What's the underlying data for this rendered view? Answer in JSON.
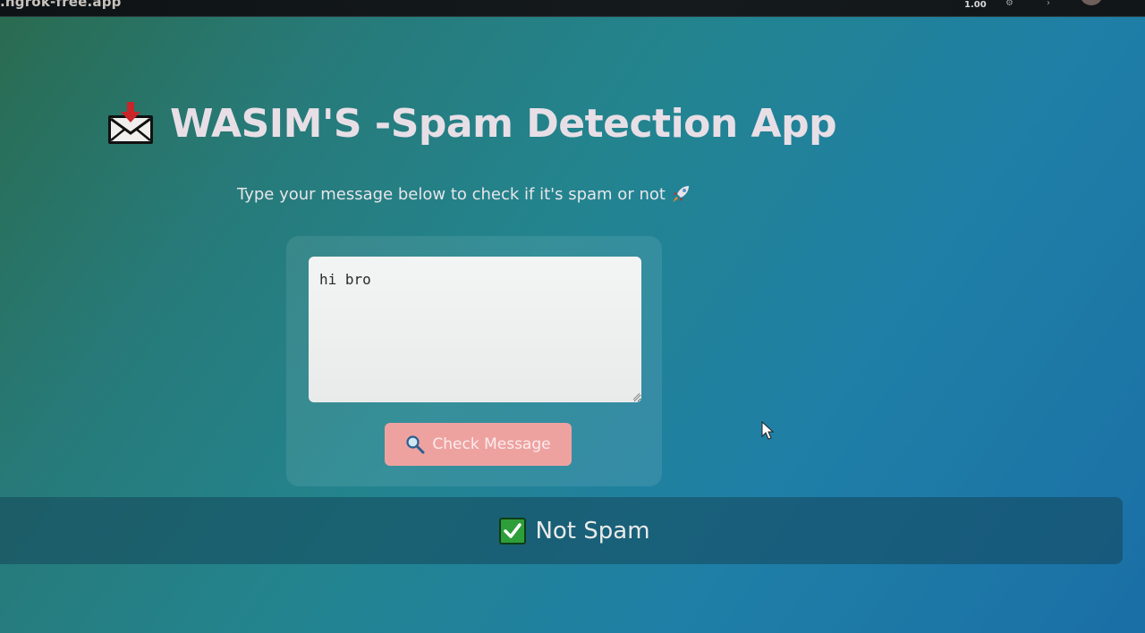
{
  "browser": {
    "url_fragment": ".ngrok-free.app",
    "zoom_level": "1.00"
  },
  "header": {
    "icon": "inbox-tray-icon",
    "title": "WASIM'S -Spam Detection App"
  },
  "subtitle": {
    "text": "Type your message below to check if it's spam or not",
    "icon": "rocket-icon"
  },
  "form": {
    "message_value": "hi bro",
    "button_icon": "search-icon",
    "button_label": "Check Message"
  },
  "result": {
    "icon": "check-mark-icon",
    "text": "Not Spam"
  },
  "colors": {
    "button": "#eea2a0",
    "result_check": "#2e9e3a",
    "title": "#e8dfe6"
  }
}
